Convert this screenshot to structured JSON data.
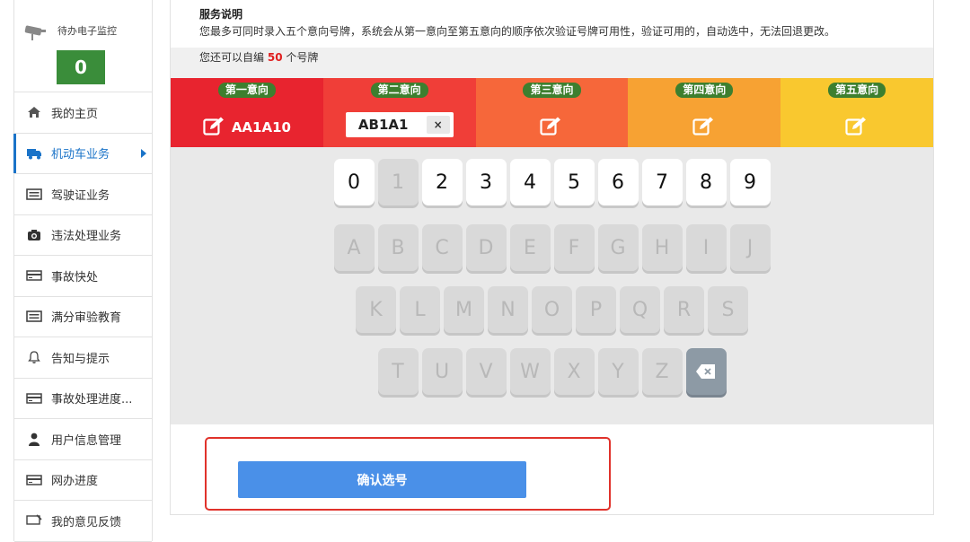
{
  "sidebar": {
    "monitor_label": "待办电子监控",
    "monitor_count": "0",
    "items": [
      {
        "label": "我的主页",
        "icon": "home-icon"
      },
      {
        "label": "机动车业务",
        "icon": "truck-icon",
        "active": true
      },
      {
        "label": "驾驶证业务",
        "icon": "license-card-icon"
      },
      {
        "label": "违法处理业务",
        "icon": "camera-icon"
      },
      {
        "label": "事故快处",
        "icon": "card-icon"
      },
      {
        "label": "满分审验教育",
        "icon": "license-card-icon"
      },
      {
        "label": "告知与提示",
        "icon": "bell-icon"
      },
      {
        "label": "事故处理进度...",
        "icon": "card-icon"
      },
      {
        "label": "用户信息管理",
        "icon": "user-icon"
      },
      {
        "label": "网办进度",
        "icon": "card-icon"
      },
      {
        "label": "我的意见反馈",
        "icon": "feedback-icon"
      }
    ]
  },
  "notice": {
    "title": "服务说明",
    "body": "您最多可同时录入五个意向号牌，系统会从第一意向至第五意向的顺序依次验证号牌可用性，验证可用的，自动选中，无法回退更改。"
  },
  "remaining": {
    "prefix": "您还可以自编",
    "count": "50",
    "suffix": "个号牌"
  },
  "options": [
    {
      "tag": "第一意向",
      "plate": "AA1A10",
      "color": "#e8242f"
    },
    {
      "tag": "第二意向",
      "input_value": "AB1A1",
      "clear_label": "×",
      "color": "#f03e38"
    },
    {
      "tag": "第三意向",
      "color": "#f6673a"
    },
    {
      "tag": "第四意向",
      "color": "#f7a233"
    },
    {
      "tag": "第五意向",
      "color": "#f9c82f"
    }
  ],
  "keyboard": {
    "row1": [
      {
        "k": "0",
        "on": true
      },
      {
        "k": "1",
        "on": false
      },
      {
        "k": "2",
        "on": true
      },
      {
        "k": "3",
        "on": true
      },
      {
        "k": "4",
        "on": true
      },
      {
        "k": "5",
        "on": true
      },
      {
        "k": "6",
        "on": true
      },
      {
        "k": "7",
        "on": true
      },
      {
        "k": "8",
        "on": true
      },
      {
        "k": "9",
        "on": true
      }
    ],
    "row2": [
      "A",
      "B",
      "C",
      "D",
      "E",
      "F",
      "G",
      "H",
      "I",
      "J"
    ],
    "row3": [
      "K",
      "L",
      "M",
      "N",
      "O",
      "P",
      "Q",
      "R",
      "S"
    ],
    "row4": [
      "T",
      "U",
      "V",
      "W",
      "X",
      "Y",
      "Z"
    ]
  },
  "confirm_label": "确认选号"
}
